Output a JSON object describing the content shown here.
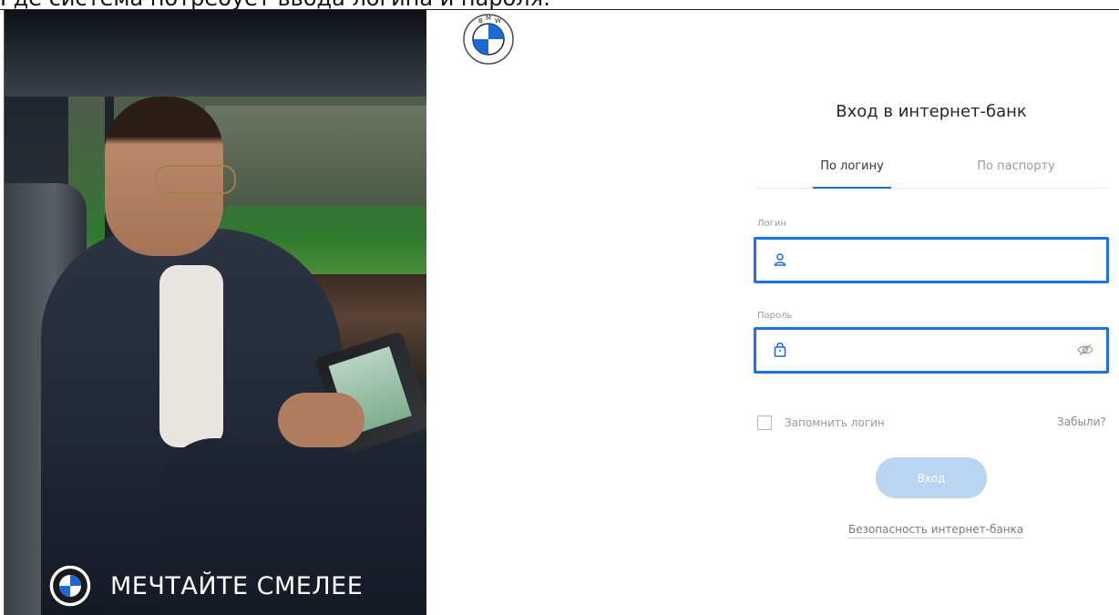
{
  "caption": "Где система потребует ввода логина и пароля:",
  "promo": {
    "slogan": "МЕЧТАЙТЕ СМЕЛЕЕ"
  },
  "brand": {
    "logo_letters": "BMW",
    "colors": {
      "blue": "#1c69d4",
      "dark": "#262626"
    }
  },
  "login_form": {
    "title": "Вход в интернет-банк",
    "tabs": [
      {
        "label": "По логину",
        "active": true
      },
      {
        "label": "По паспорту",
        "active": false
      }
    ],
    "login_label": "Логин",
    "login_value": "",
    "login_icon": "user-icon",
    "password_label": "Пароль",
    "password_value": "",
    "password_icon": "lock-icon",
    "visibility_icon": "eye-off-icon",
    "remember_label": "Запомнить логин",
    "remember_checked": false,
    "forgot_label": "Забыли?",
    "submit_label": "Вход",
    "security_link": "Безопасность интернет-банка"
  },
  "highlight_color": "#1a73e8",
  "button_color": "#b9d5f2"
}
